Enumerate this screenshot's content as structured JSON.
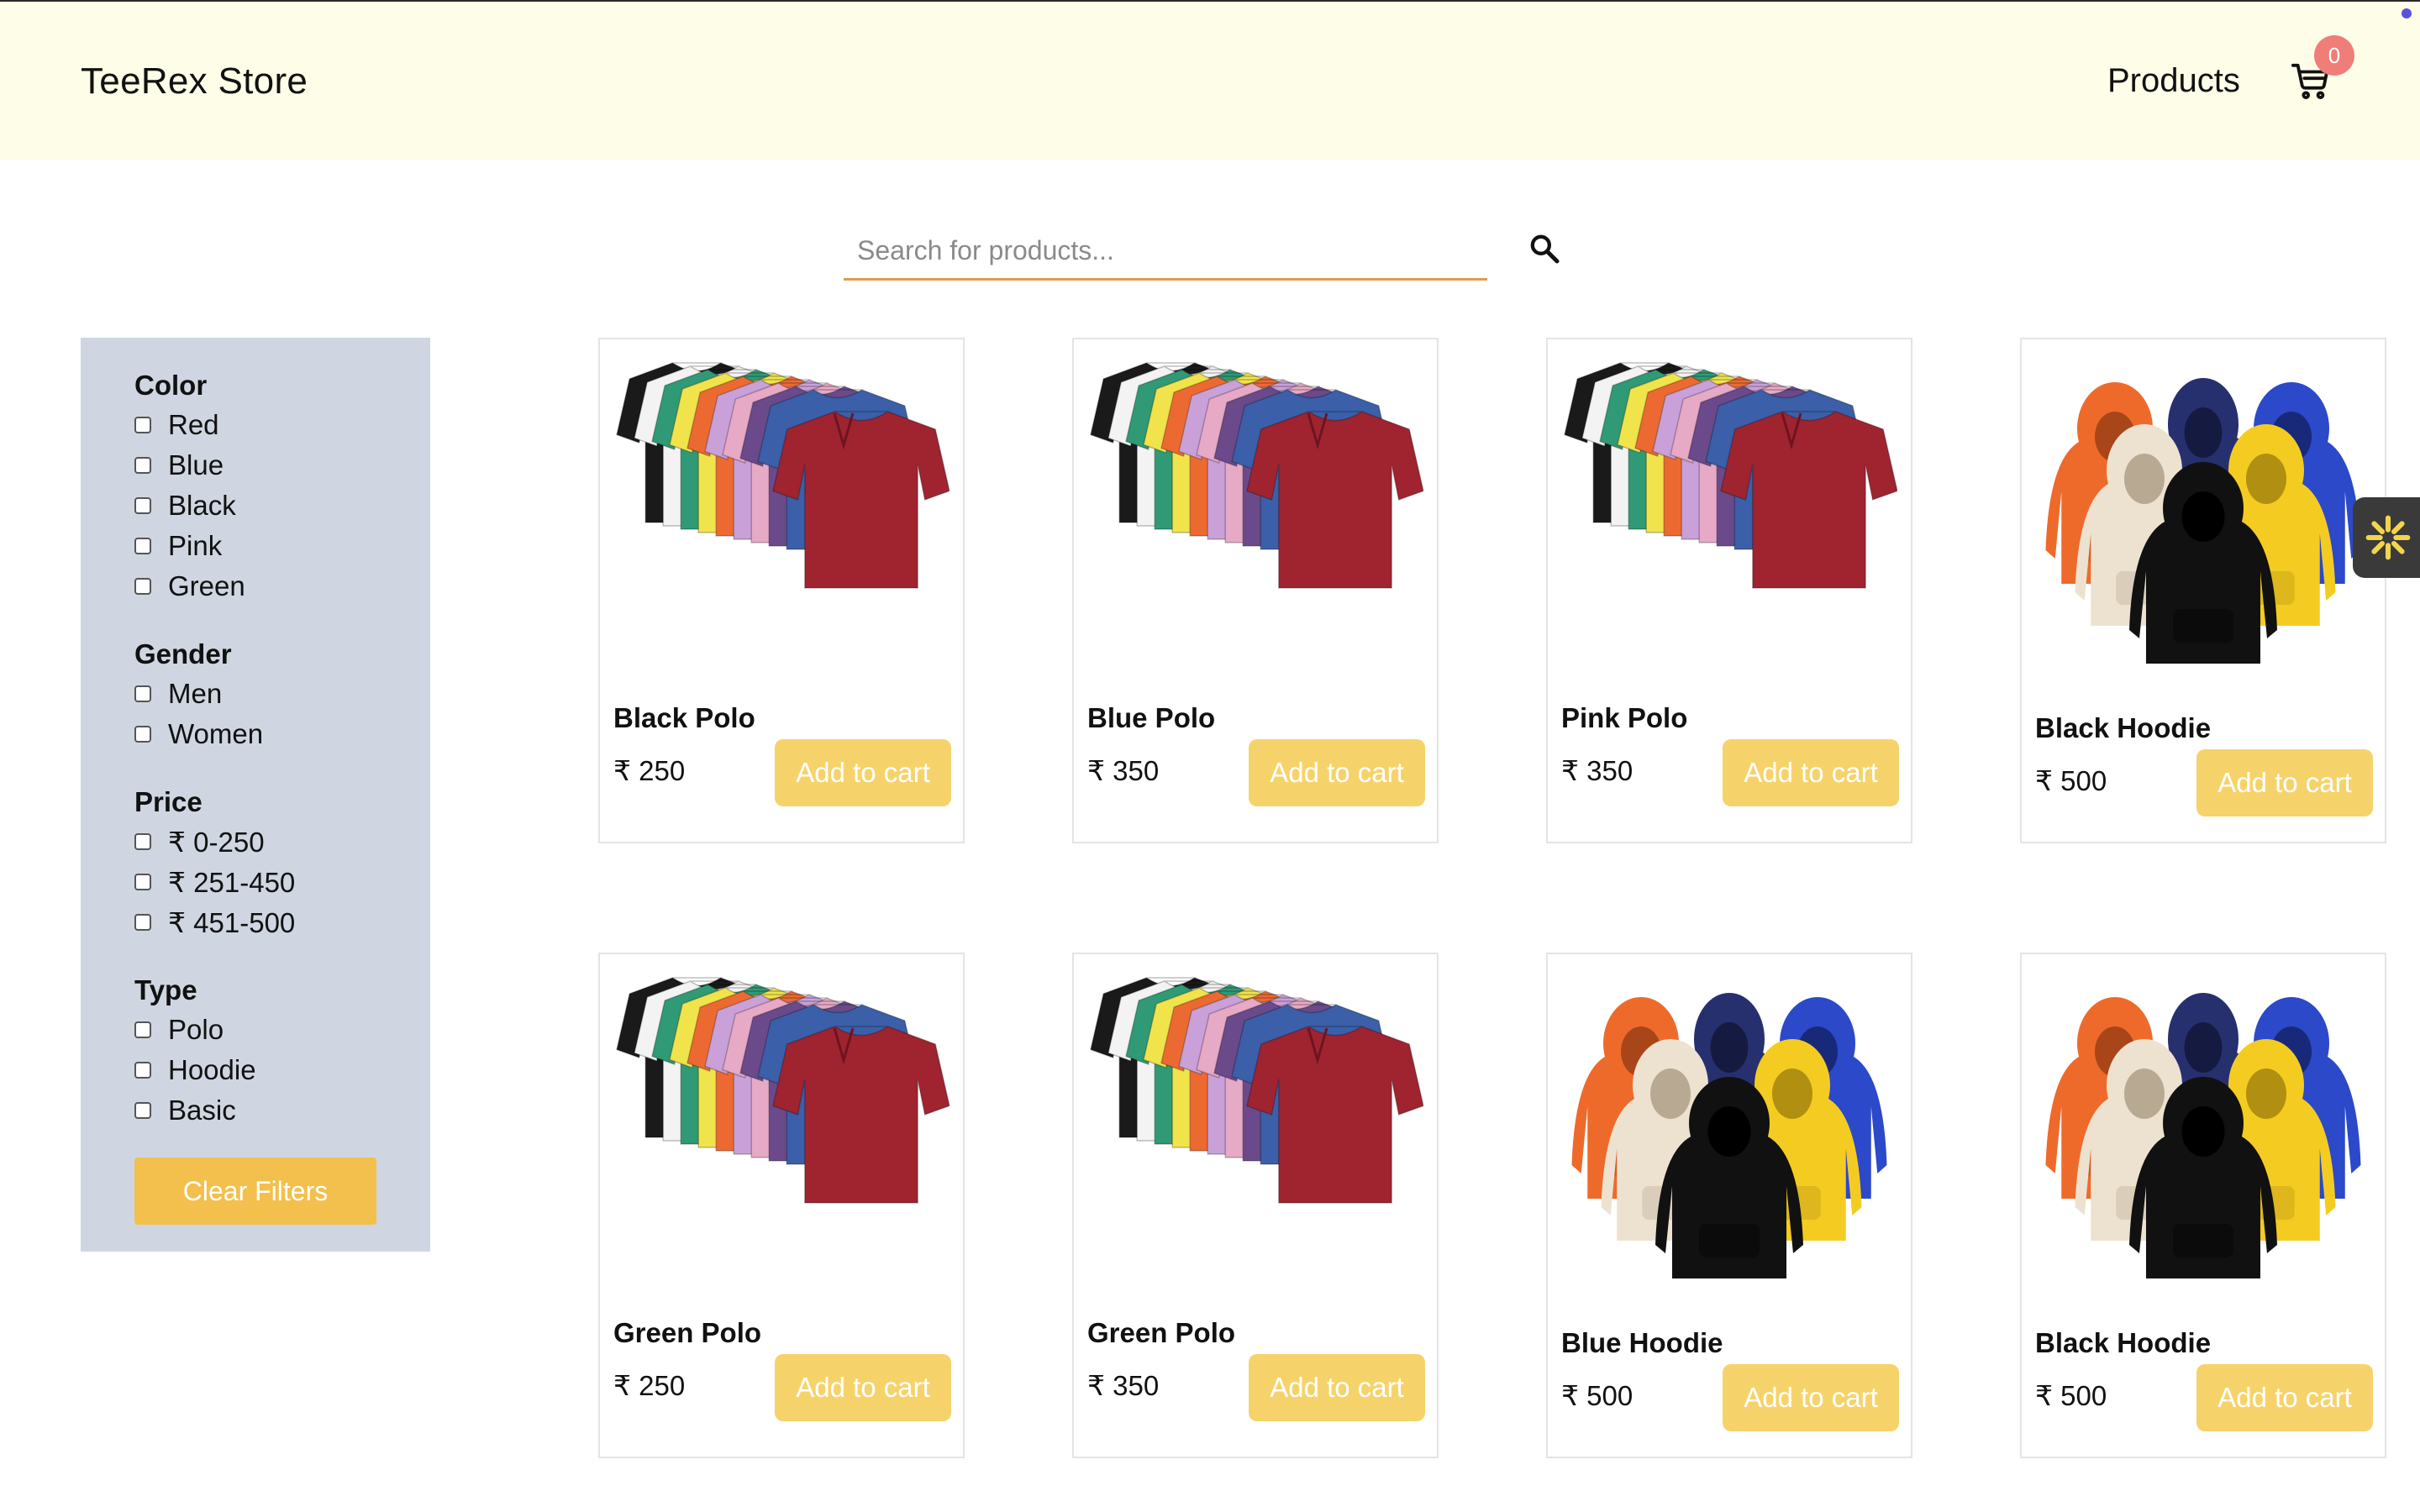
{
  "header": {
    "brand": "TeeRex Store",
    "nav_products": "Products",
    "cart_count": "0"
  },
  "search": {
    "placeholder": "Search for products...",
    "value": ""
  },
  "filters": {
    "color": {
      "title": "Color",
      "options": [
        "Red",
        "Blue",
        "Black",
        "Pink",
        "Green"
      ]
    },
    "gender": {
      "title": "Gender",
      "options": [
        "Men",
        "Women"
      ]
    },
    "price": {
      "title": "Price",
      "options": [
        "₹ 0-250",
        "₹ 251-450",
        "₹ 451-500"
      ]
    },
    "type": {
      "title": "Type",
      "options": [
        "Polo",
        "Hoodie",
        "Basic"
      ]
    },
    "clear_label": "Clear Filters"
  },
  "products": [
    {
      "name": "Black Polo",
      "price": "₹ 250",
      "add_label": "Add to cart"
    },
    {
      "name": "Blue Polo",
      "price": "₹ 350",
      "add_label": "Add to cart"
    },
    {
      "name": "Pink Polo",
      "price": "₹ 350",
      "add_label": "Add to cart"
    },
    {
      "name": "Black Hoodie",
      "price": "₹ 500",
      "add_label": "Add to cart"
    },
    {
      "name": "Green Polo",
      "price": "₹ 250",
      "add_label": "Add to cart"
    },
    {
      "name": "Green Polo",
      "price": "₹ 350",
      "add_label": "Add to cart"
    },
    {
      "name": "Blue Hoodie",
      "price": "₹ 500",
      "add_label": "Add to cart"
    },
    {
      "name": "Black Hoodie",
      "price": "₹ 500",
      "add_label": "Add to cart"
    }
  ],
  "icons": {
    "cart": "shopping-cart-icon",
    "search": "search-icon",
    "widget": "sparkle-icon"
  },
  "colors": {
    "header_bg": "#fefde8",
    "sidebar_bg": "#cfd6e1",
    "button_yellow": "#f6d36a",
    "clear_button": "#f3c04d",
    "search_underline": "#e29a4e",
    "badge": "#ef7d78"
  }
}
